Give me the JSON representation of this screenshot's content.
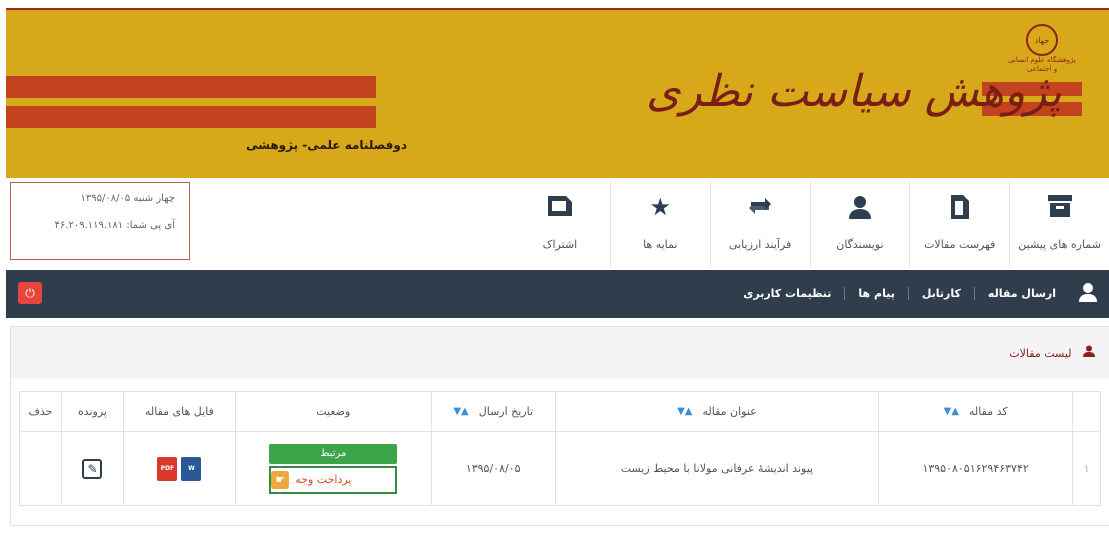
{
  "banner": {
    "title": "پژوهش سیاست نظری",
    "subtitle": "دوفصلنامه علمی- پژوهشی",
    "logo_text": "جهاد",
    "logo_caption": "پژوهشگاه علوم انسانی و اجتماعی"
  },
  "info": {
    "date_line": "چهار شنبه ۱۳۹۵/۰۸/۰۵",
    "ip_line": "آی پی شما: ۴۶.۲۰۹.۱۱۹.۱۸۱"
  },
  "nav": [
    {
      "label": "شماره های پیشین",
      "icon": "archive-icon"
    },
    {
      "label": "فهرست مقالات",
      "icon": "document-icon"
    },
    {
      "label": "نویسندگان",
      "icon": "user-icon"
    },
    {
      "label": "فرآیند ارزیابی",
      "icon": "exchange-icon"
    },
    {
      "label": "نمایه ها",
      "icon": "star-icon"
    },
    {
      "label": "اشتراک",
      "icon": "subscription-icon"
    }
  ],
  "darkbar": {
    "links": [
      "ارسال مقاله",
      "کارتابل",
      "پیام ها",
      "تنظیمات کاربری"
    ]
  },
  "panel": {
    "title": "لیست مقالات"
  },
  "table": {
    "headers": [
      "کد مقاله",
      "عنوان مقاله",
      "تاریخ ارسال",
      "وضعیت",
      "فایل های مقاله",
      "پرونده",
      "حذف"
    ],
    "rows": [
      {
        "index": "۱",
        "code": "۱۳۹۵۰۸۰۵۱۶۲۹۴۶۳۷۴۲",
        "title": "پیوند اندیشۀ عرفانی مولانا با محیط زیست",
        "date": "۱۳۹۵/۰۸/۰۵",
        "status": "مرتبط",
        "pay_label": "پرداخت وجه"
      }
    ]
  },
  "colors": {
    "banner_bg": "#d7a91a",
    "banner_stripe": "#c2431e",
    "darkbar_bg": "#2f3d4c",
    "status_green": "#3ea449",
    "power_red": "#e8453c",
    "sort_blue": "#3a8fd6"
  }
}
